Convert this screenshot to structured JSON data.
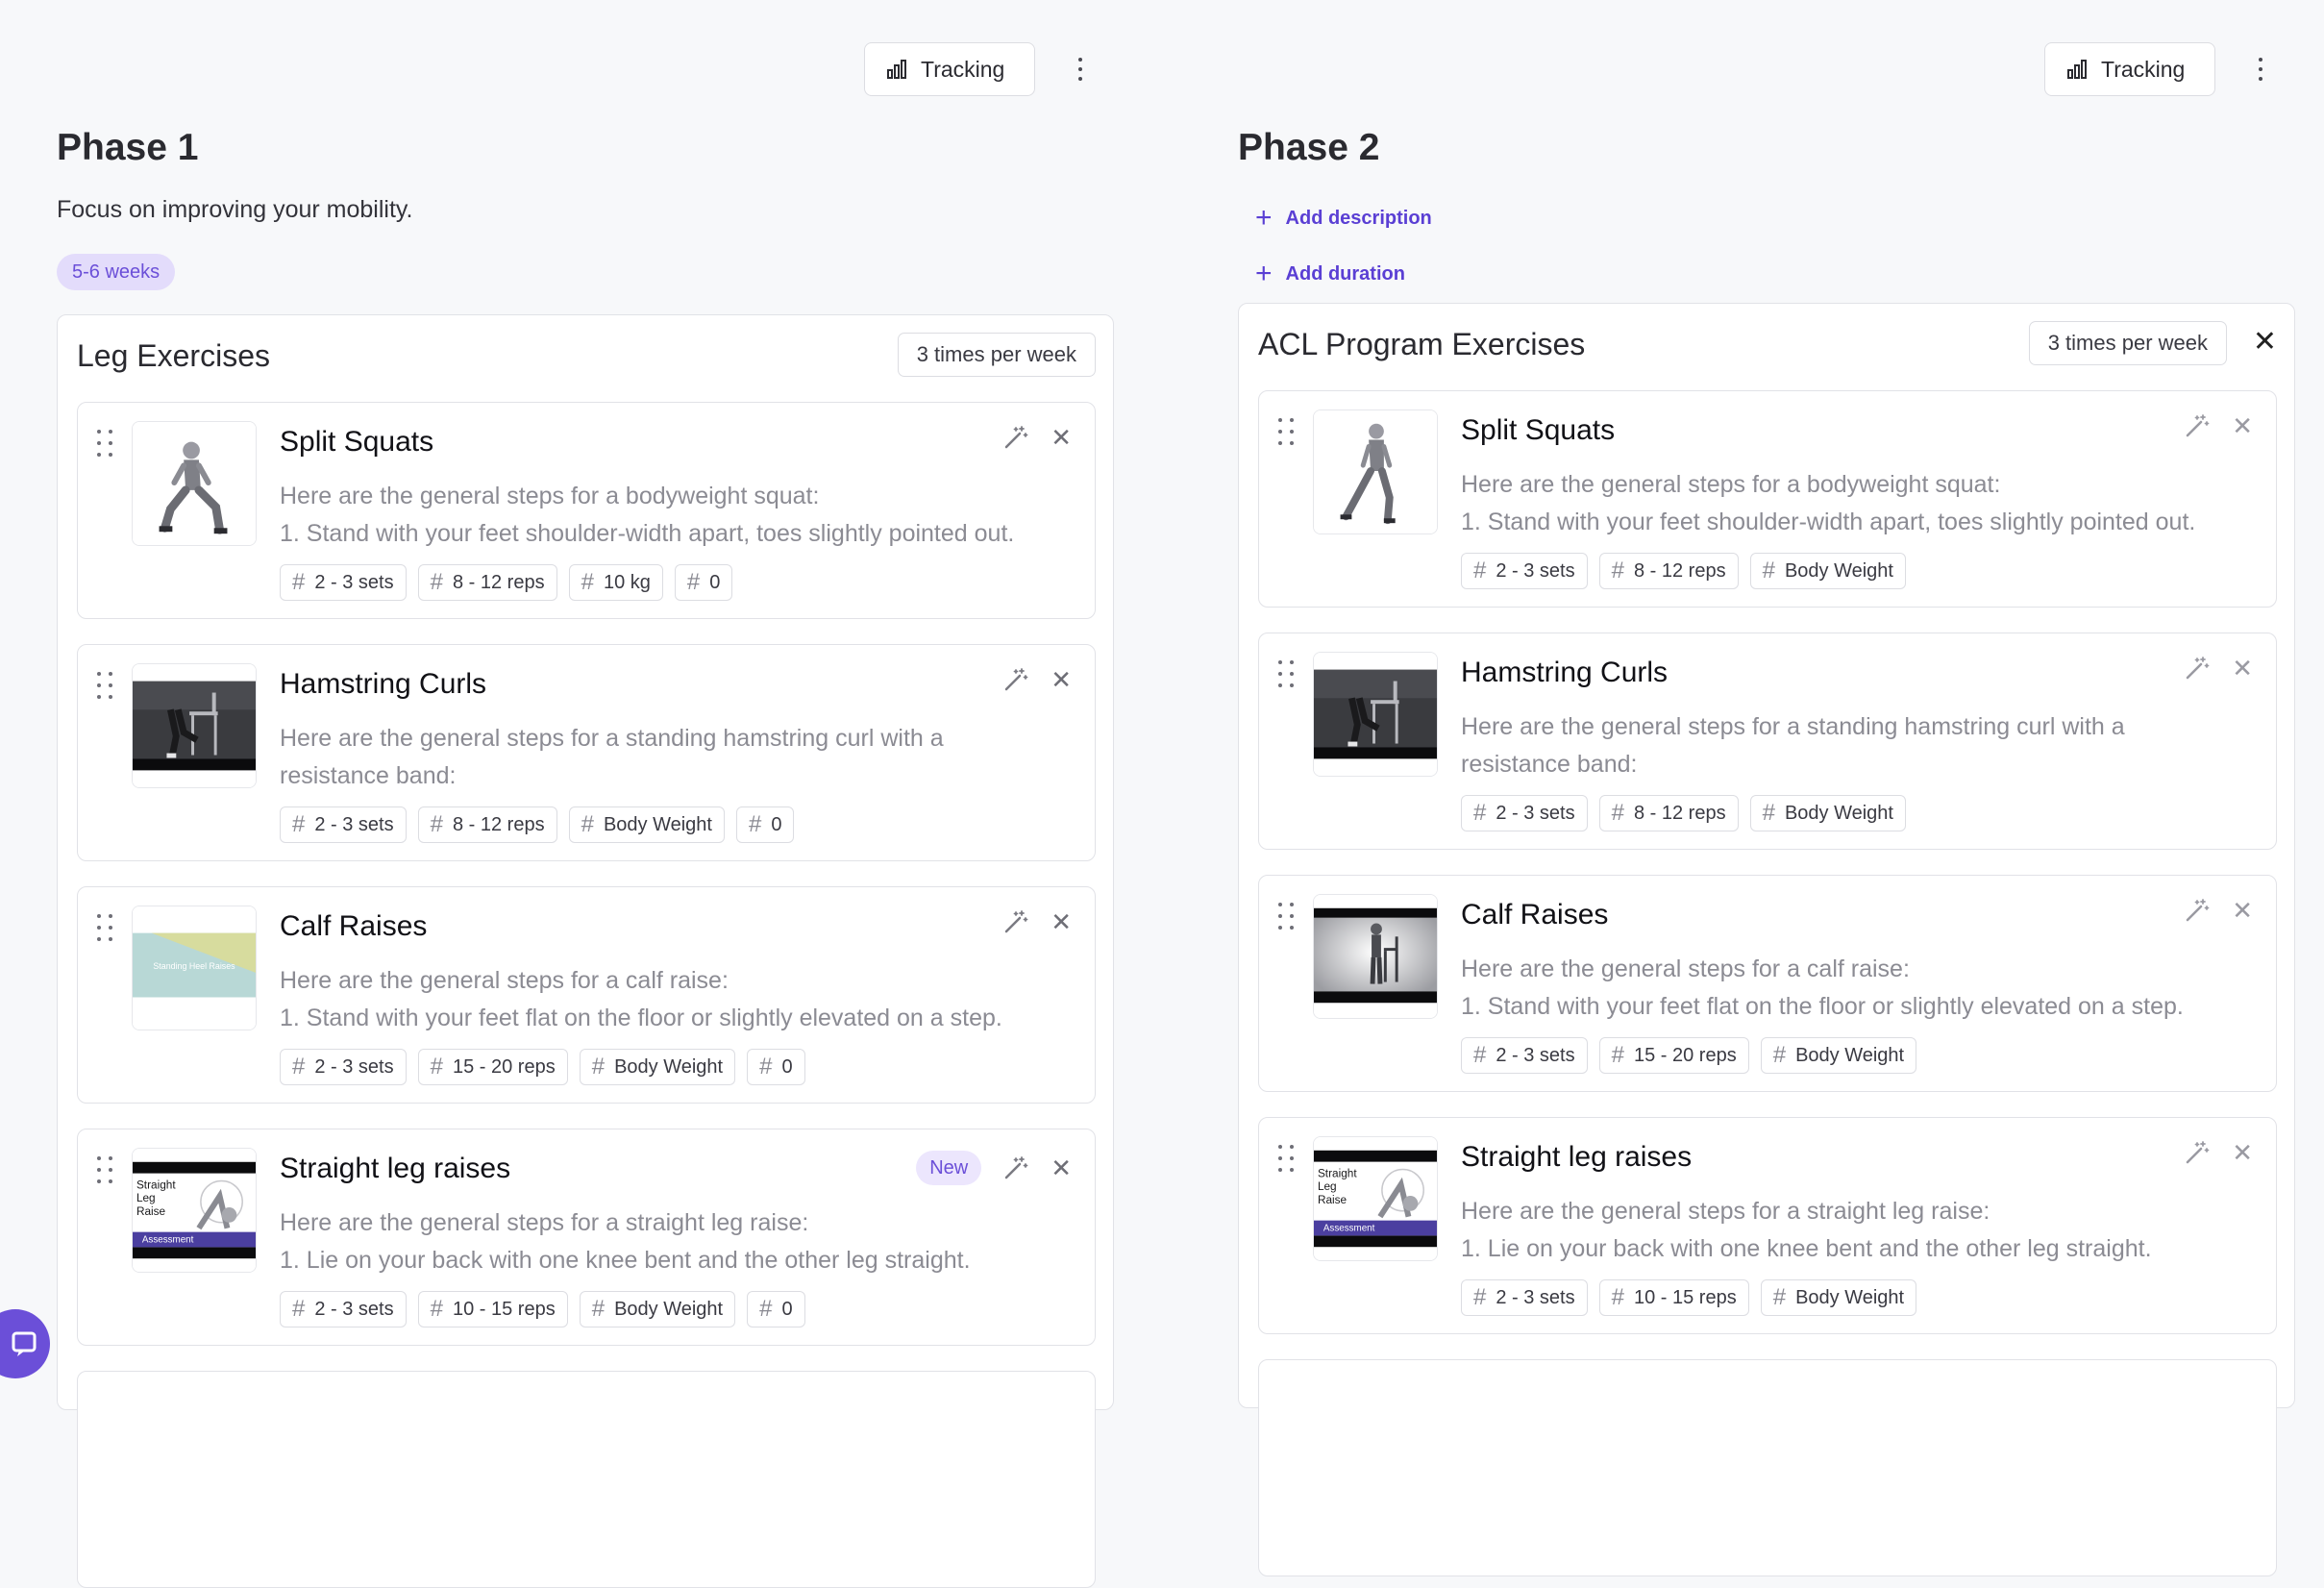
{
  "phases": [
    {
      "tracking_label": "Tracking",
      "title": "Phase 1",
      "description": "Focus on improving your mobility.",
      "duration": "5-6 weeks",
      "group": {
        "title": "Leg Exercises",
        "frequency": "3 times per week",
        "exercises": [
          {
            "title": "Split Squats",
            "desc1": "Here are the general steps for a bodyweight squat:",
            "desc2": "1. Stand with your feet shoulder-width apart, toes slightly pointed out.",
            "chips": [
              "2 - 3 sets",
              "8 - 12 reps",
              "10 kg",
              "0"
            ]
          },
          {
            "title": "Hamstring Curls",
            "desc1": "Here are the general steps for a standing hamstring curl with a",
            "desc2": "resistance band:",
            "chips": [
              "2 - 3 sets",
              "8 - 12 reps",
              "Body Weight",
              "0"
            ]
          },
          {
            "title": "Calf Raises",
            "desc1": "Here are the general steps for a calf raise:",
            "desc2": "1. Stand with your feet flat on the floor or slightly elevated on a step.",
            "chips": [
              "2 - 3 sets",
              "15 - 20 reps",
              "Body Weight",
              "0"
            ],
            "thumb_text": "Standing Heel Raises"
          },
          {
            "title": "Straight leg raises",
            "desc1": "Here are the general steps for a straight leg raise:",
            "desc2": "1. Lie on your back with one knee bent and the other leg straight.",
            "chips": [
              "2 - 3 sets",
              "10 - 15 reps",
              "Body Weight",
              "0"
            ],
            "badge": "New",
            "thumb_lines": [
              "Straight",
              "Leg",
              "Raise"
            ],
            "thumb_caption": "Assessment"
          }
        ]
      }
    },
    {
      "tracking_label": "Tracking",
      "title": "Phase 2",
      "add_description": "Add description",
      "add_duration": "Add duration",
      "group": {
        "title": "ACL Program Exercises",
        "frequency": "3 times per week",
        "exercises": [
          {
            "title": "Split Squats",
            "desc1": "Here are the general steps for a bodyweight squat:",
            "desc2": "1. Stand with your feet shoulder-width apart, toes slightly pointed out.",
            "chips": [
              "2 - 3 sets",
              "8 - 12 reps",
              "Body Weight"
            ]
          },
          {
            "title": "Hamstring Curls",
            "desc1": "Here are the general steps for a standing hamstring curl with a",
            "desc2": "resistance band:",
            "chips": [
              "2 - 3 sets",
              "8 - 12 reps",
              "Body Weight"
            ]
          },
          {
            "title": "Calf Raises",
            "desc1": "Here are the general steps for a calf raise:",
            "desc2": "1. Stand with your feet flat on the floor or slightly elevated on a step.",
            "chips": [
              "2 - 3 sets",
              "15 - 20 reps",
              "Body Weight"
            ]
          },
          {
            "title": "Straight leg raises",
            "desc1": "Here are the general steps for a straight leg raise:",
            "desc2": "1. Lie on your back with one knee bent and the other leg straight.",
            "chips": [
              "2 - 3 sets",
              "10 - 15 reps",
              "Body Weight"
            ],
            "thumb_lines": [
              "Straight",
              "Leg",
              "Raise"
            ],
            "thumb_caption": "Assessment"
          }
        ]
      }
    }
  ],
  "icons": {
    "tracking": "bar-chart-icon",
    "more": "more-vertical-icon",
    "drag": "drag-handle-icon",
    "ai": "magic-wand-icon",
    "remove": "close-icon",
    "add": "plus-icon",
    "help": "chat-bubble-icon"
  },
  "colors": {
    "accent": "#6b4fd8",
    "badge_bg": "#e3dcfb",
    "link": "#5a3fd4",
    "muted_text": "#8b8b93"
  }
}
